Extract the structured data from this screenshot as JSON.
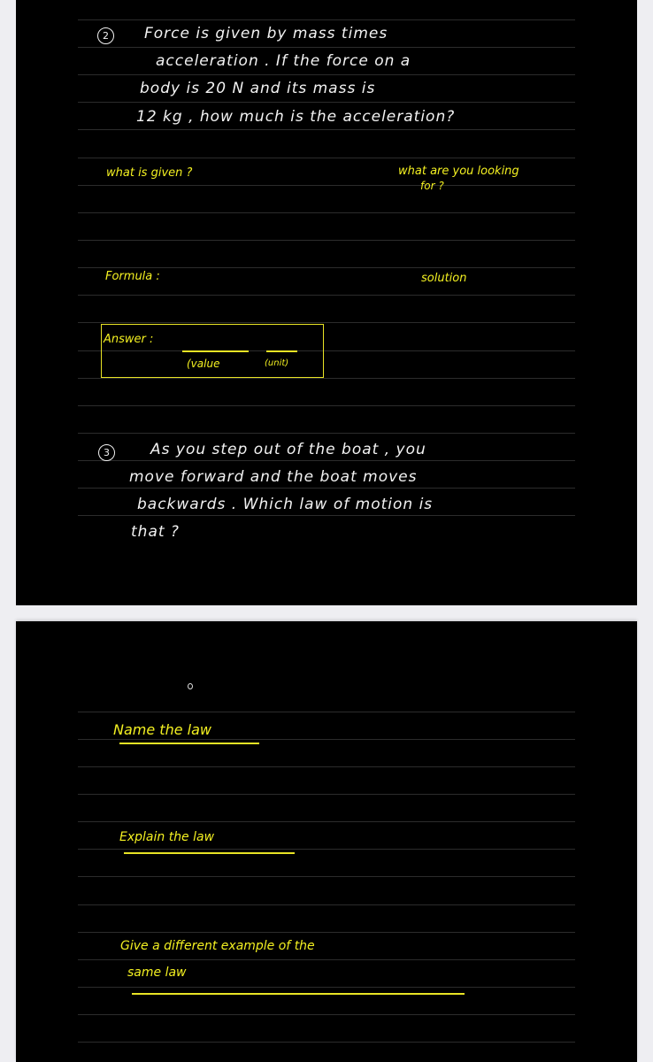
{
  "page1": {
    "q2": {
      "number": "2",
      "lines": [
        "Force   is   given   by   mass  times",
        "acceleration .  If  the  force  on  a",
        "body    is   20 N    and  its  mass  is",
        "12 kg ,    how    much is   the  acceleration?"
      ]
    },
    "prompts": {
      "given": "what  is  given ?",
      "looking_for_line1": "what are you looking",
      "looking_for_line2": "for ?",
      "formula": "Formula :",
      "solution": "solution"
    },
    "answer": {
      "label": "Answer :",
      "value_label": "(value",
      "unit_label": "(unit)"
    },
    "q3": {
      "number": "3",
      "lines": [
        "As   you  step out    of the  boat ,  you",
        "move    forward    and  the    boat  moves",
        "backwards . Which  law   of  motion  is",
        "that ?"
      ]
    }
  },
  "page2": {
    "name_law": "Name the law",
    "explain_law": "Explain  the law",
    "example_line1": "Give  a  different  example  of  the",
    "example_line2": "same  law"
  },
  "colors": {
    "page_background": "#000000",
    "gap_background": "#eeeef2",
    "ink_white": "#f2f2f2",
    "ink_yellow": "#f3f021",
    "rule": "#2c2c2c"
  }
}
